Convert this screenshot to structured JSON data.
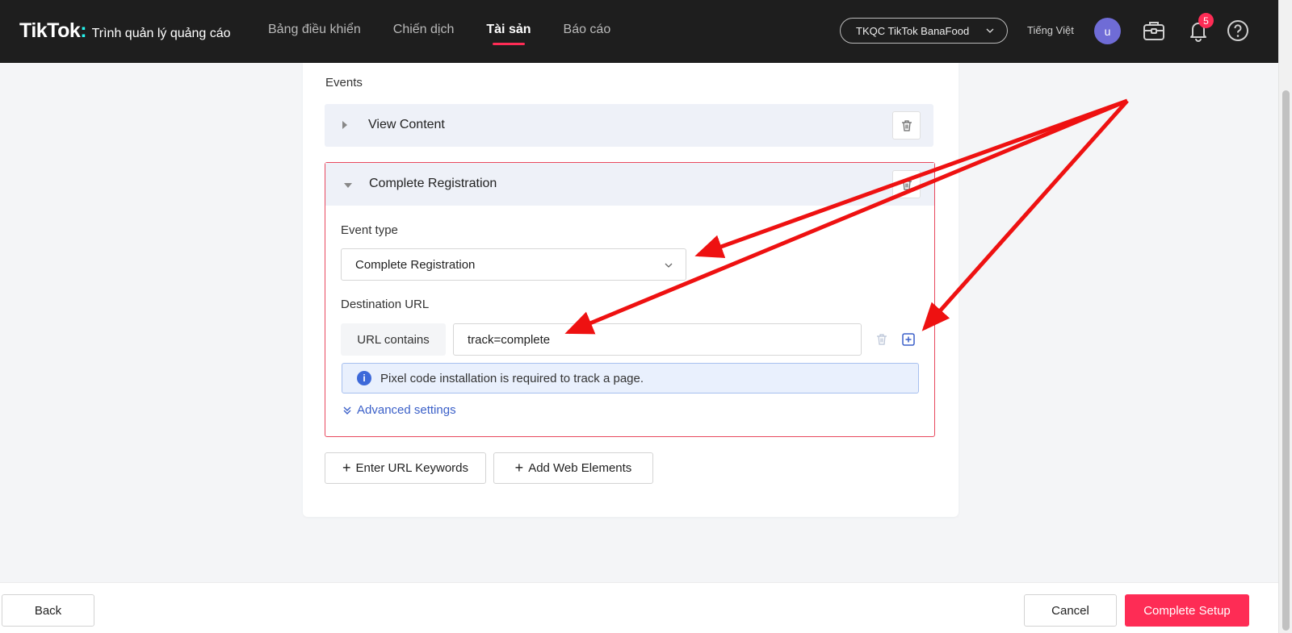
{
  "header": {
    "logo": "TikTok",
    "logo_colon": ":",
    "subtitle": "Trình quản lý quảng cáo",
    "nav": [
      "Bảng điều khiển",
      "Chiến dịch",
      "Tài sản",
      "Báo cáo"
    ],
    "active_nav": "Tài sản",
    "account": "TKQC TikTok BanaFood",
    "language": "Tiếng Việt",
    "avatar_letter": "u",
    "notification_count": "5",
    "icons": [
      "briefcase-icon",
      "bell-icon",
      "help-icon"
    ]
  },
  "events": {
    "title": "Events",
    "collapsed_event": "View Content",
    "expanded_event": {
      "name": "Complete Registration",
      "event_type_label": "Event type",
      "event_type_value": "Complete Registration",
      "destination_label": "Destination URL",
      "url_condition": "URL contains",
      "url_value": "track=complete",
      "info_text": "Pixel code installation is required to track a page.",
      "advanced_settings": "Advanced settings"
    },
    "add_url_keywords": "Enter URL Keywords",
    "add_web_elements": "Add Web Elements"
  },
  "footer": {
    "back": "Back",
    "cancel": "Cancel",
    "complete": "Complete Setup"
  },
  "colors": {
    "primary": "#fe2c55",
    "topbar": "#1e1e1e",
    "link": "#3a5fc8",
    "annotation_arrow": "#ee1111"
  }
}
